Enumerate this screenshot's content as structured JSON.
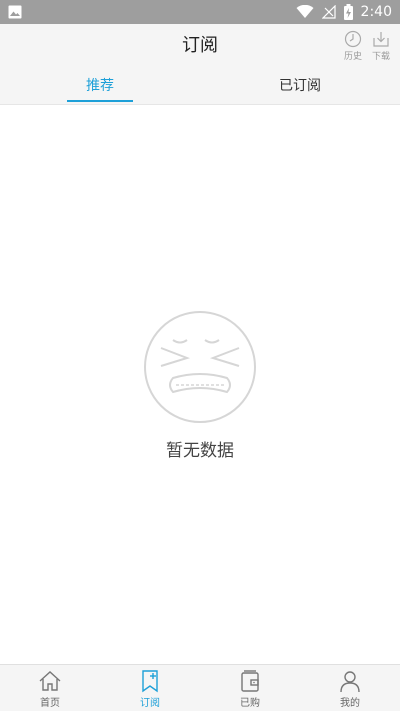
{
  "status_bar": {
    "time": "2:40",
    "icons": [
      "image-icon",
      "wifi-icon",
      "signal-icon",
      "battery-icon"
    ]
  },
  "header": {
    "title": "订阅",
    "actions": [
      {
        "label": "历史",
        "icon": "history-icon"
      },
      {
        "label": "下载",
        "icon": "download-icon"
      }
    ]
  },
  "tabs": [
    {
      "label": "推荐",
      "active": true
    },
    {
      "label": "已订阅",
      "active": false
    }
  ],
  "empty_state": {
    "icon": "sad-face-icon",
    "message": "暂无数据"
  },
  "bottom_nav": [
    {
      "label": "首页",
      "icon": "home-icon",
      "active": false
    },
    {
      "label": "订阅",
      "icon": "subscribe-icon",
      "active": true
    },
    {
      "label": "已购",
      "icon": "wallet-icon",
      "active": false
    },
    {
      "label": "我的",
      "icon": "user-icon",
      "active": false
    }
  ],
  "colors": {
    "accent": "#1ea0d8",
    "status_bar": "#9e9e9e",
    "header_bg": "#f5f5f5"
  }
}
